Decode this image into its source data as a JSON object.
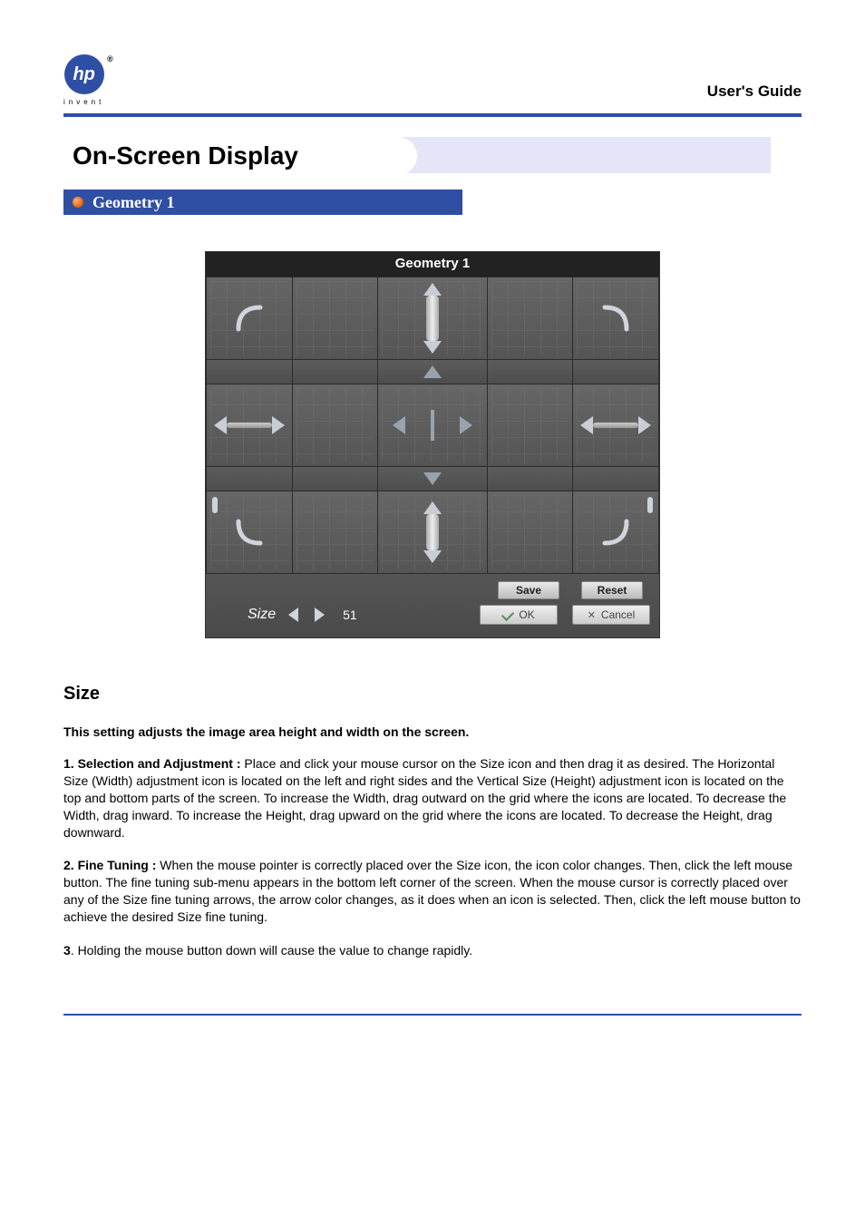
{
  "header": {
    "logo_text": "invent",
    "logo_mark": "hp",
    "guide_title": "User's Guide"
  },
  "banner": {
    "title": "On-Screen Display"
  },
  "subbanner": {
    "title": "Geometry 1"
  },
  "osd": {
    "title": "Geometry 1",
    "size_label": "Size",
    "size_value": "51",
    "buttons": {
      "save": "Save",
      "reset": "Reset",
      "ok": "OK",
      "cancel": "Cancel"
    }
  },
  "content": {
    "section_title": "Size",
    "lead": "This setting adjusts the image area height and width on the screen.",
    "p1_lead": "1. Selection and Adjustment :",
    "p1_body": " Place and click your mouse cursor on the Size icon and then drag it as desired. The Horizontal Size (Width) adjustment icon is located on the left and right sides and the Vertical Size (Height) adjustment icon is located on the top and bottom parts of the screen. To increase the Width, drag outward on the grid where the icons are located. To decrease the Width, drag inward. To increase the Height, drag upward on the grid where the icons are located. To decrease the Height, drag downward.",
    "p2_lead": "2. Fine Tuning :",
    "p2_body": " When the mouse pointer is correctly placed over the Size icon, the icon color changes. Then, click the left mouse button. The fine tuning sub-menu appears in the bottom left corner of the screen. When the mouse cursor is correctly placed over any of the Size fine tuning arrows, the arrow color changes, as it does when an icon is selected. Then, click the left mouse button to achieve the desired Size fine tuning.",
    "p3_lead": "3",
    "p3_body": ". Holding the mouse button down will cause the value to change rapidly."
  }
}
